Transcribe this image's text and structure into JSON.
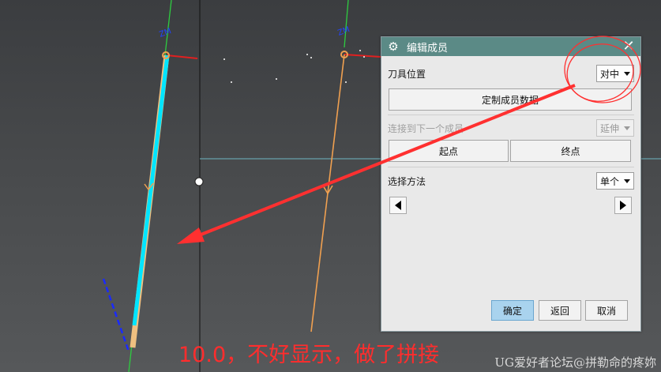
{
  "dialog": {
    "title": "编辑成员",
    "tool_position_label": "刀具位置",
    "tool_position_value": "对中",
    "customize_button": "定制成员数据",
    "connect_label": "连接到下一个成员",
    "connect_value": "延伸",
    "start_button": "起点",
    "end_button": "终点",
    "select_method_label": "选择方法",
    "select_method_value": "单个",
    "ok_button": "确定",
    "back_button": "返回",
    "cancel_button": "取消"
  },
  "caption": "10.0，不好显示，做了拼接",
  "watermark": "UG爱好者论坛@拼勒命的疼妳",
  "colors": {
    "title_bar": "#5b8a86",
    "annotation_red": "#ff2d2d",
    "toolpath_cyan": "#00e5ff",
    "toolpath_orange": "#f0a050",
    "axis_green": "#2ecc40",
    "ok_button": "#a9d3ee"
  }
}
